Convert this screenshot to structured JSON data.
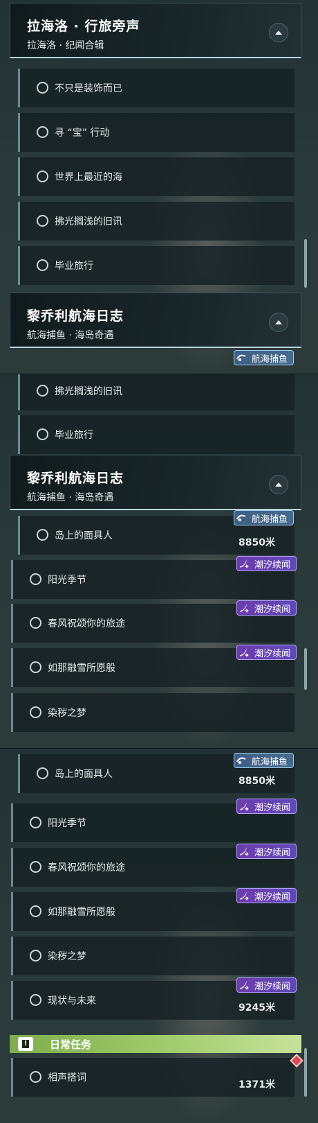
{
  "panel1": {
    "header": {
      "title": "拉海洛 · 行旅旁声",
      "subtitle": "拉海洛 · 纪闻合辑"
    },
    "items": [
      {
        "label": "不只是装饰而已"
      },
      {
        "label": "寻 “宝” 行动"
      },
      {
        "label": "世界上最近的海"
      },
      {
        "label": "拂光搁浅的旧讯"
      },
      {
        "label": "毕业旅行"
      }
    ],
    "header2": {
      "title": "黎乔利航海日志",
      "subtitle": "航海捕鱼 · 海岛奇遇"
    },
    "badge": "航海捕鱼"
  },
  "panel2": {
    "items": [
      {
        "label": "拂光搁浅的旧讯"
      },
      {
        "label": "毕业旅行"
      }
    ],
    "header": {
      "title": "黎乔利航海日志",
      "subtitle": "航海捕鱼 · 海岛奇遇"
    },
    "quests": [
      {
        "label": "岛上的面具人",
        "badge": "航海捕鱼",
        "distance": "8850米"
      },
      {
        "label": "阳光季节",
        "badge": "潮汐续闻"
      },
      {
        "label": "春风祝颂你的旅途",
        "badge": "潮汐续闻"
      },
      {
        "label": "如那融雪所愿般",
        "badge": "潮汐续闻"
      },
      {
        "label": "染秽之梦"
      }
    ]
  },
  "panel3": {
    "quests": [
      {
        "label": "岛上的面具人",
        "badge": "航海捕鱼",
        "distance": "8850米"
      },
      {
        "label": "阳光季节",
        "badge": "潮汐续闻"
      },
      {
        "label": "春风祝颂你的旅途",
        "badge": "潮汐续闻"
      },
      {
        "label": "如那融雪所愿般",
        "badge": "潮汐续闻"
      },
      {
        "label": "染秽之梦"
      },
      {
        "label": "现状与未来",
        "badge": "潮汐续闻",
        "distance": "9245米"
      }
    ],
    "daily": {
      "title": "日常任务",
      "icon": "!"
    },
    "daily_items": [
      {
        "label": "相声搭词",
        "distance": "1371米"
      }
    ]
  },
  "colors": {
    "purple_badge": "#6d3cae",
    "teal_badge": "#3e5f86",
    "daily_green": "#9ec968",
    "marker_red": "#d94a53"
  }
}
